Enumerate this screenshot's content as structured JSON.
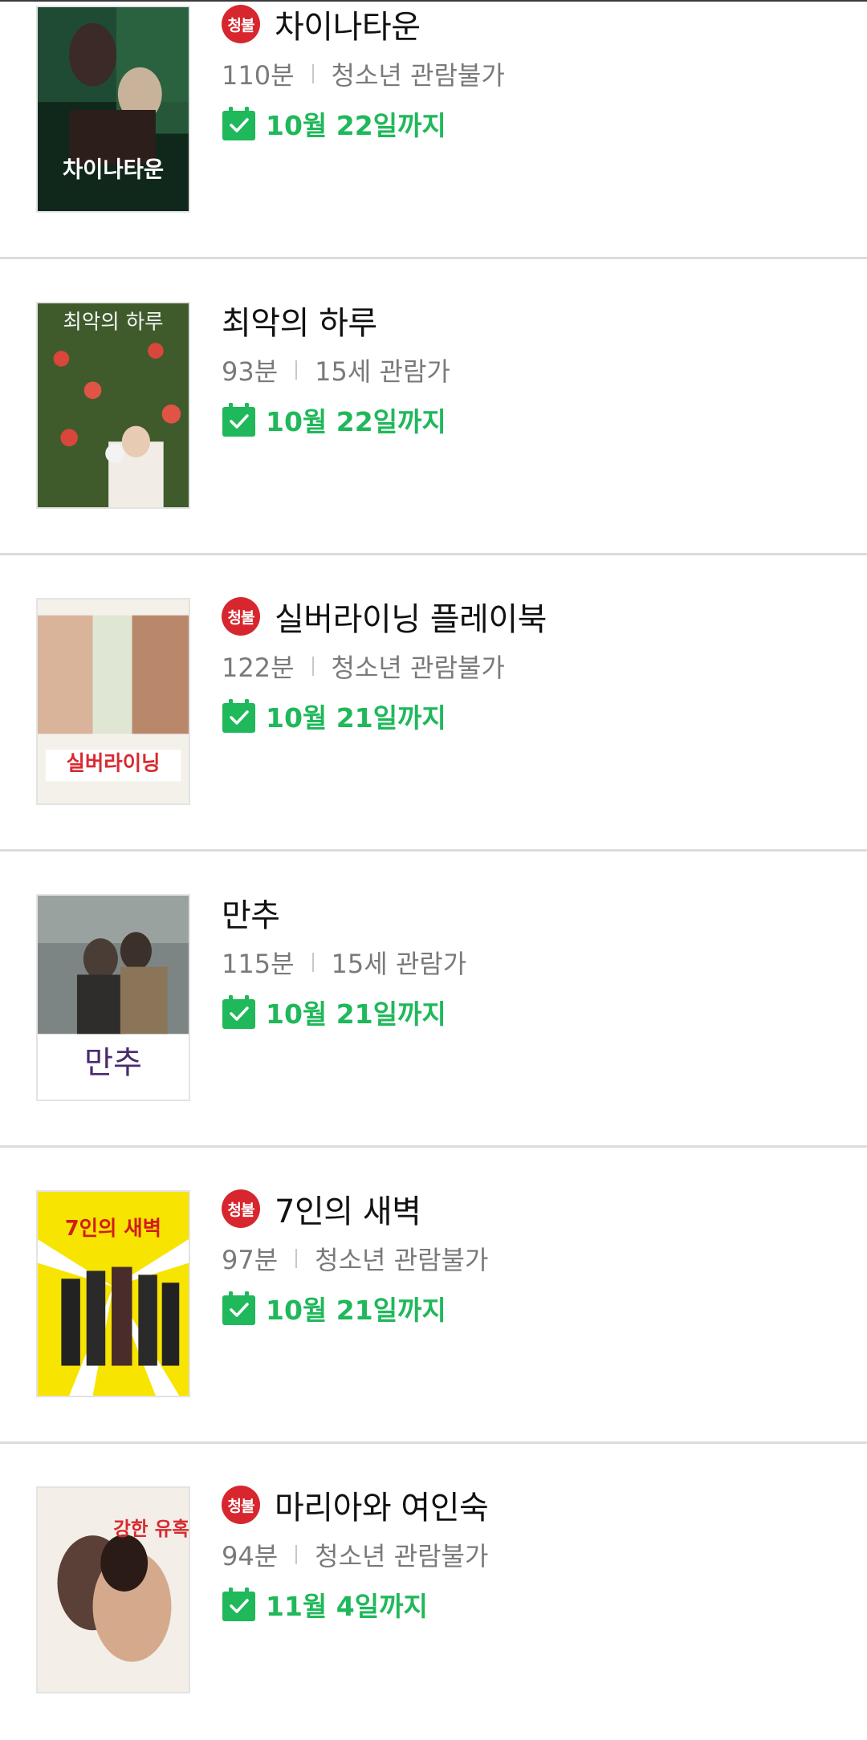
{
  "colors": {
    "accent_green": "#1fb85a",
    "restricted_red": "#d7262e",
    "meta_gray": "#7a7a7a",
    "divider": "#dcdcdc"
  },
  "movies": [
    {
      "title": "차이나타운",
      "rating_badge": "청불",
      "duration": "110분",
      "age_rating": "청소년 관람불가",
      "until": "10월 22일까지",
      "poster_title": "차이나타운"
    },
    {
      "title": "최악의 하루",
      "rating_badge": "",
      "duration": "93분",
      "age_rating": "15세 관람가",
      "until": "10월 22일까지",
      "poster_title": "최악의 하루"
    },
    {
      "title": "실버라이닝 플레이북",
      "rating_badge": "청불",
      "duration": "122분",
      "age_rating": "청소년 관람불가",
      "until": "10월 21일까지",
      "poster_title": "실버라이닝"
    },
    {
      "title": "만추",
      "rating_badge": "",
      "duration": "115분",
      "age_rating": "15세 관람가",
      "until": "10월 21일까지",
      "poster_title": "만추"
    },
    {
      "title": "7인의 새벽",
      "rating_badge": "청불",
      "duration": "97분",
      "age_rating": "청소년 관람불가",
      "until": "10월 21일까지",
      "poster_title": "7인의 새벽"
    },
    {
      "title": "마리아와 여인숙",
      "rating_badge": "청불",
      "duration": "94분",
      "age_rating": "청소년 관람불가",
      "until": "11월 4일까지",
      "poster_title": "강한 유혹!"
    }
  ],
  "icons": {
    "calendar": "calendar-check-icon"
  }
}
